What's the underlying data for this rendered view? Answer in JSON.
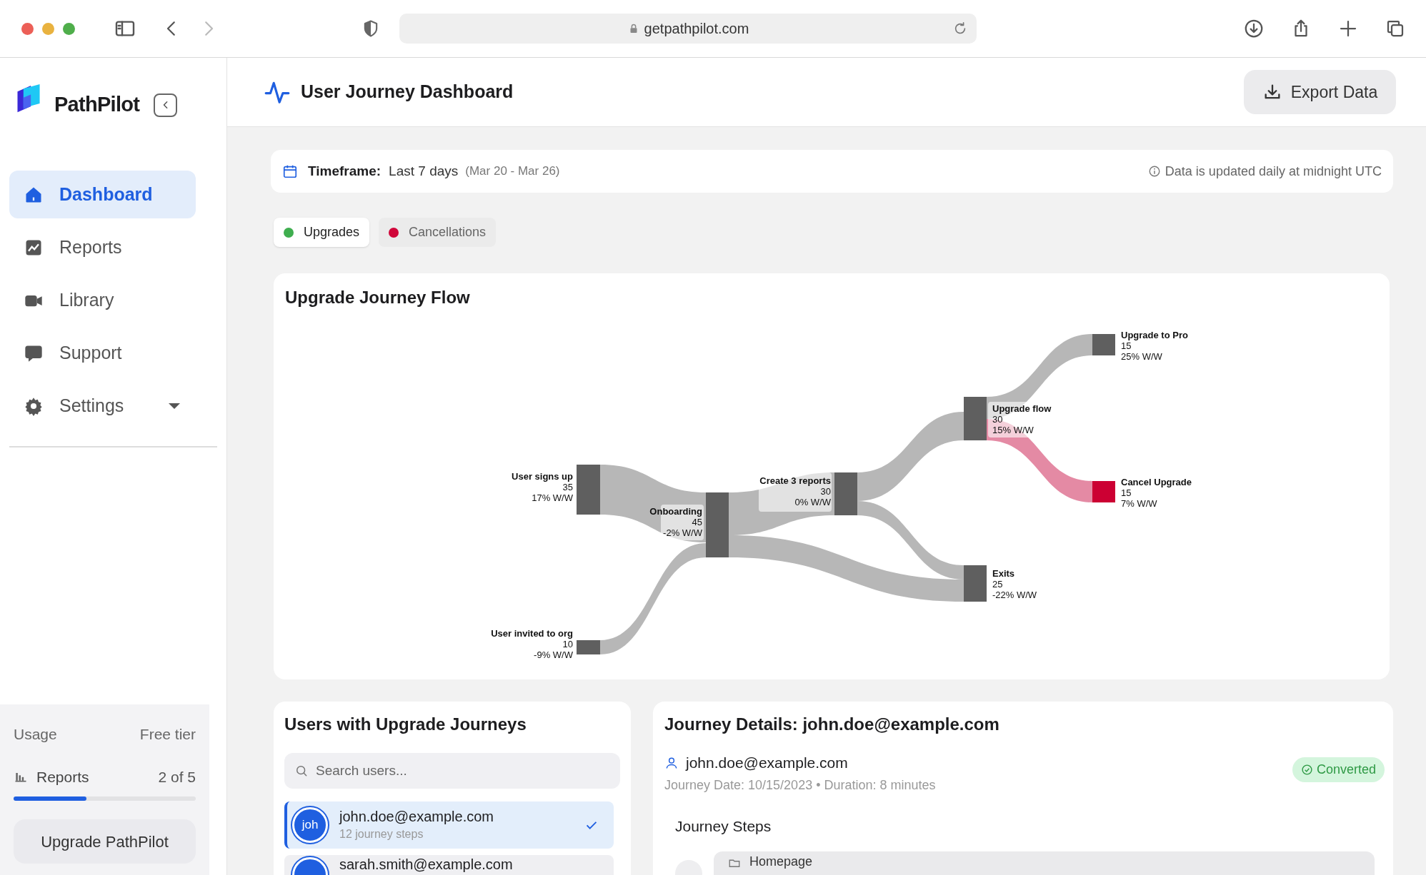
{
  "browser": {
    "url": "getpathpilot.com"
  },
  "sidebar": {
    "brand": "PathPilot",
    "items": [
      {
        "label": "Dashboard",
        "selected": true,
        "kind": "link"
      },
      {
        "label": "Reports",
        "selected": false,
        "kind": "link"
      },
      {
        "label": "Library",
        "selected": false,
        "kind": "link"
      },
      {
        "label": "Support",
        "selected": false,
        "kind": "link"
      },
      {
        "label": "Settings",
        "selected": false,
        "kind": "group"
      }
    ],
    "usage": {
      "title": "Usage",
      "tier": "Free tier",
      "metric": "Reports",
      "count": "2 of 5",
      "level": 0.4,
      "button": "Upgrade PathPilot"
    }
  },
  "header": {
    "title": "User Journey Dashboard",
    "export_button": "Export Data"
  },
  "timeframe": {
    "label": "Timeframe:",
    "value": "Last 7 days",
    "range": "(Mar 20 - Mar 26)",
    "note": "Data is updated daily at midnight UTC"
  },
  "tabs": [
    {
      "label": "Upgrades",
      "color": "#3fae4f",
      "selected": true
    },
    {
      "label": "Cancellations",
      "color": "#d0063a",
      "selected": false
    }
  ],
  "flow": {
    "title": "Upgrade Journey Flow",
    "nodes": [
      {
        "label": "User signs up",
        "count": "35",
        "change": "17% W/W",
        "color": "#5f5f5f"
      },
      {
        "label": "User invited to org",
        "count": "10",
        "change": "-9% W/W",
        "color": "#5f5f5f"
      },
      {
        "label": "Onboarding",
        "count": "45",
        "change": "-2% W/W",
        "color": "#5f5f5f"
      },
      {
        "label": "Create 3 reports",
        "count": "30",
        "change": "0% W/W",
        "color": "#5f5f5f"
      },
      {
        "label": "Upgrade flow",
        "count": "30",
        "change": "15% W/W",
        "color": "#5f5f5f"
      },
      {
        "label": "Exits",
        "count": "25",
        "change": "-22% W/W",
        "color": "#5f5f5f"
      },
      {
        "label": "Upgrade to Pro",
        "count": "15",
        "change": "25% W/W",
        "color": "#5f5f5f"
      },
      {
        "label": "Cancel Upgrade",
        "count": "15",
        "change": "7% W/W",
        "color": "#cc0033"
      }
    ],
    "links": [
      {
        "color": "#b7b7b7"
      },
      {
        "color": "#b7b7b7"
      },
      {
        "color": "#b7b7b7"
      },
      {
        "color": "#b7b7b7"
      },
      {
        "color": "#b7b7b7"
      },
      {
        "color": "#b7b7b7"
      },
      {
        "color": "#b7b7b7"
      },
      {
        "color": "#e48aa4"
      }
    ]
  },
  "users_panel": {
    "title": "Users with Upgrade Journeys",
    "search_placeholder": "Search users...",
    "users": [
      {
        "initials": "joh",
        "email": "john.doe@example.com",
        "steps": "12 journey steps",
        "selected": true
      },
      {
        "email": "sarah.smith@example.com",
        "selected": false
      }
    ]
  },
  "details": {
    "title": "Journey Details: john.doe@example.com",
    "email": "john.doe@example.com",
    "meta": "Journey Date: 10/15/2023 • Duration: 8 minutes",
    "status": "Converted",
    "steps_title": "Journey Steps",
    "steps": [
      {
        "label": "Homepage"
      }
    ]
  }
}
